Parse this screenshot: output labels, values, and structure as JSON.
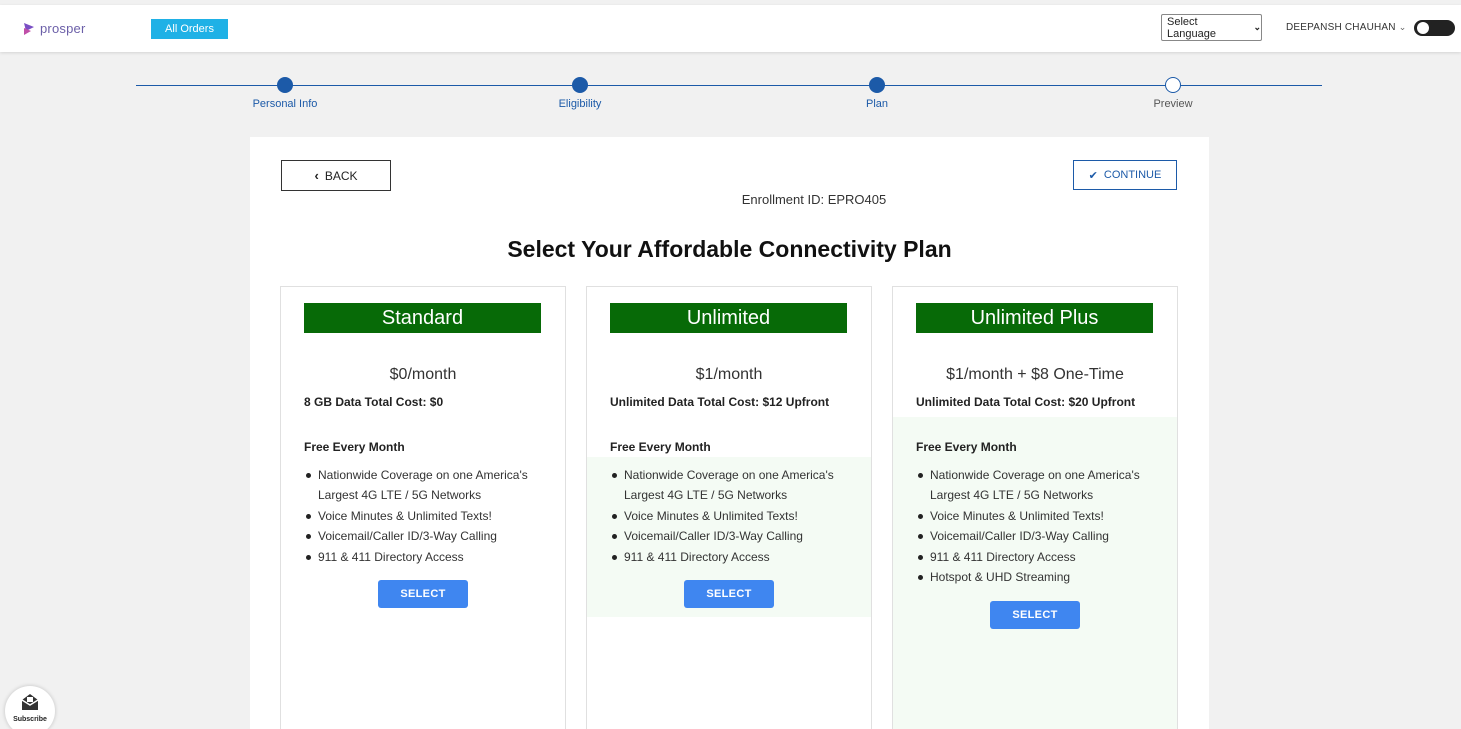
{
  "header": {
    "logo_text": "prosper",
    "all_orders_label": "All Orders",
    "language_select": "Select Language",
    "user_name": "DEEPANSH CHAUHAN",
    "theme_toggle_on": true
  },
  "stepper": {
    "steps": [
      {
        "label": "Personal Info",
        "done": true
      },
      {
        "label": "Eligibility",
        "done": true
      },
      {
        "label": "Plan",
        "done": true
      },
      {
        "label": "Preview",
        "done": false
      }
    ]
  },
  "actions": {
    "back_label": "BACK",
    "continue_label": "CONTINUE"
  },
  "enrollment": "Enrollment ID: EPRO405",
  "page_title": "Select Your Affordable Connectivity Plan",
  "plans": [
    {
      "name": "Standard",
      "price": "$0/month",
      "cost": "8 GB Data Total Cost: $0",
      "free_heading": "Free Every Month",
      "features": [
        "Nationwide Coverage on one America's Largest 4G LTE / 5G Networks",
        "Voice Minutes & Unlimited Texts!",
        "Voicemail/Caller ID/3-Way Calling",
        "911 & 411 Directory Access"
      ],
      "select_label": "SELECT"
    },
    {
      "name": "Unlimited",
      "price": "$1/month",
      "cost": "Unlimited Data Total Cost: $12 Upfront",
      "free_heading": "Free Every Month",
      "features": [
        "Nationwide Coverage on one America's Largest 4G LTE / 5G Networks",
        "Voice Minutes & Unlimited Texts!",
        "Voicemail/Caller ID/3-Way Calling",
        "911 & 411 Directory Access"
      ],
      "select_label": "SELECT"
    },
    {
      "name": "Unlimited Plus",
      "price": "$1/month + $8 One-Time",
      "cost": "Unlimited Data Total Cost: $20 Upfront",
      "free_heading": "Free Every Month",
      "features": [
        "Nationwide Coverage on one America's Largest 4G LTE / 5G Networks",
        "Voice Minutes & Unlimited Texts!",
        "Voicemail/Caller ID/3-Way Calling",
        "911 & 411 Directory Access",
        "Hotspot & UHD Streaming"
      ],
      "select_label": "SELECT"
    }
  ],
  "subscribe_label": "Subscribe",
  "colors": {
    "brand_blue": "#1c5aa8",
    "plan_green": "#076a07",
    "select_blue": "#3f86f0",
    "all_orders_cyan": "#1fb1e6"
  }
}
